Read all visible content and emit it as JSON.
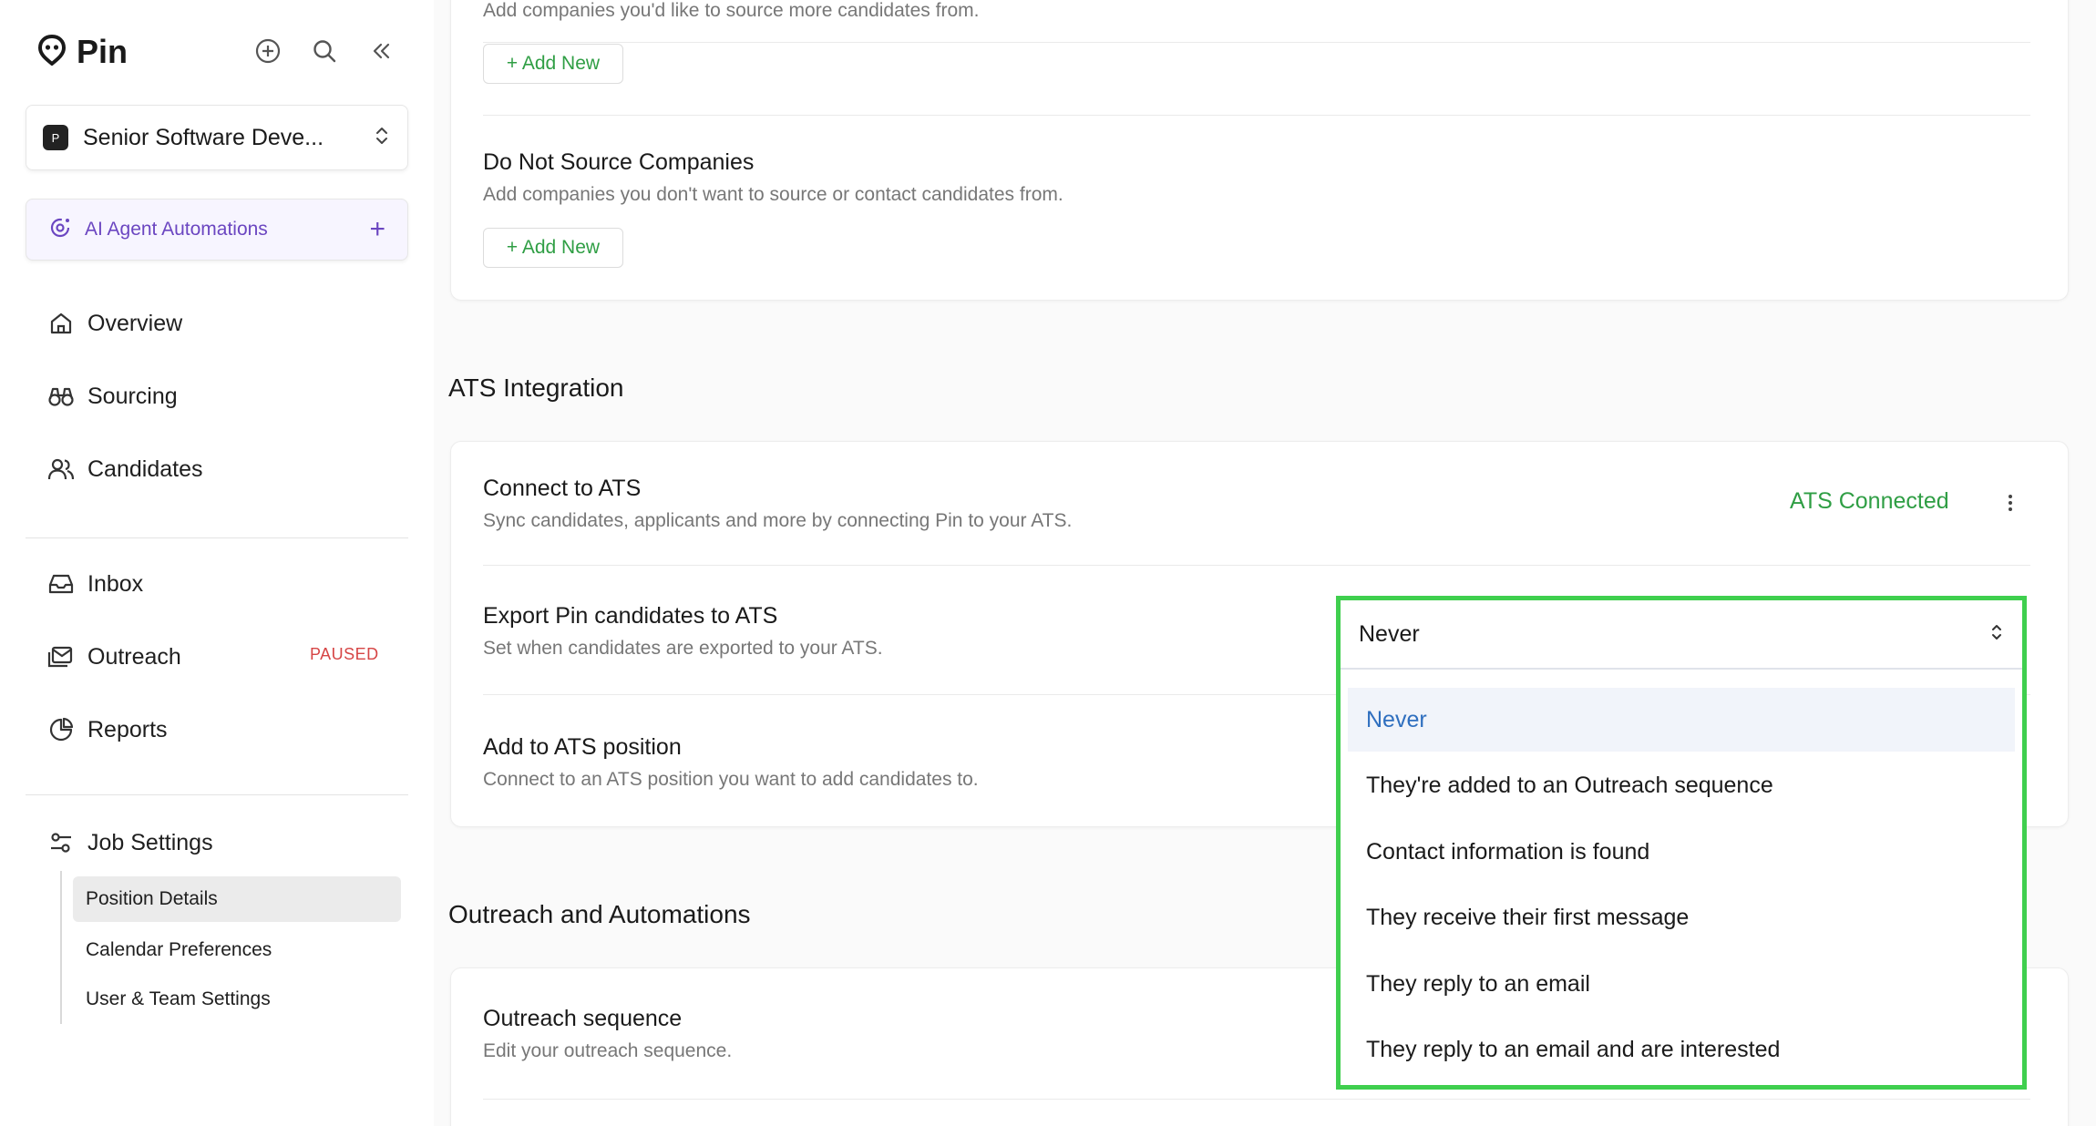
{
  "app": {
    "name": "Pin"
  },
  "sidebar": {
    "job_title": "Senior Software Deve...",
    "job_badge": "P",
    "ai_label": "AI Agent Automations",
    "nav": {
      "overview": "Overview",
      "sourcing": "Sourcing",
      "candidates": "Candidates",
      "inbox": "Inbox",
      "outreach": "Outreach",
      "outreach_status": "PAUSED",
      "reports": "Reports",
      "job_settings": "Job Settings"
    },
    "sub_items": {
      "position_details": "Position Details",
      "calendar_preferences": "Calendar Preferences",
      "user_team_settings": "User & Team Settings"
    }
  },
  "main": {
    "source_companies": {
      "desc": "Add companies you'd like to source more candidates from.",
      "add_label": "+ Add New"
    },
    "do_not_source": {
      "title": "Do Not Source Companies",
      "desc": "Add companies you don't want to source or contact candidates from.",
      "add_label": "+ Add New"
    },
    "ats_section_title": "ATS Integration",
    "connect_ats": {
      "title": "Connect to ATS",
      "desc": "Sync candidates, applicants and more by connecting Pin to your ATS.",
      "status": "ATS Connected"
    },
    "export_ats": {
      "title": "Export Pin candidates to ATS",
      "desc": "Set when candidates are exported to your ATS."
    },
    "add_ats_position": {
      "title": "Add to ATS position",
      "desc": "Connect to an ATS position you want to add candidates to."
    },
    "outreach_section_title": "Outreach and Automations",
    "outreach_sequence": {
      "title": "Outreach sequence",
      "desc": "Edit your outreach sequence."
    }
  },
  "dropdown": {
    "selected": "Never",
    "options": [
      "Never",
      "They're added to an Outreach sequence",
      "Contact information is found",
      "They receive their first message",
      "They reply to an email",
      "They reply to an email and are interested"
    ]
  },
  "colors": {
    "accent_green": "#2f9e44",
    "highlight_border": "#3fcf4e",
    "ai_purple": "#6b46c1",
    "paused_red": "#d64545",
    "selected_blue": "#2f6fbf"
  }
}
